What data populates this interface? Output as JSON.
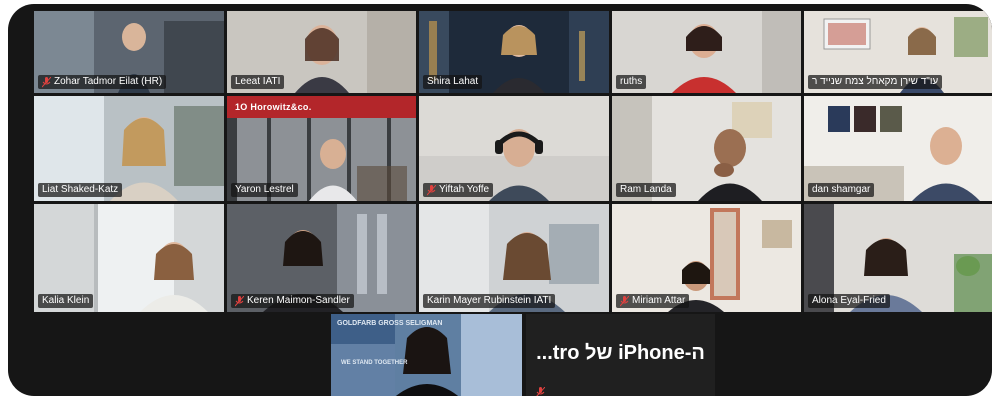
{
  "participants": [
    {
      "name": "Zohar Tadmor Eilat (HR)",
      "muted": true
    },
    {
      "name": "Leeat IATI",
      "muted": false
    },
    {
      "name": "Shira Lahat",
      "muted": false
    },
    {
      "name": "ruths",
      "muted": false
    },
    {
      "name": "עו\"ד שירן מקאחל צמח שנייד ר",
      "muted": false
    },
    {
      "name": "Liat Shaked-Katz",
      "muted": false
    },
    {
      "name": "Yaron Lestrel",
      "muted": false
    },
    {
      "name": "Yiftah Yoffe",
      "muted": true
    },
    {
      "name": "Ram Landa",
      "muted": false
    },
    {
      "name": "dan shamgar",
      "muted": false
    },
    {
      "name": "Kalia Klein",
      "muted": false
    },
    {
      "name": "Keren Maimon-Sandler",
      "muted": true
    },
    {
      "name": "Karin Mayer Rubinstein IATI",
      "muted": false
    },
    {
      "name": "Miriam Attar",
      "muted": true
    },
    {
      "name": "Alona Eyal-Fried",
      "muted": false
    }
  ],
  "background_texts": {
    "horowitz_logo": "1O Horowitz&co.",
    "corp_logo": "GOLDFARB GROSS SELIGMAN",
    "we_stand": "WE STAND TOGETHER"
  },
  "bottom_tile": {
    "display_name": "...tro של iPhone-ה"
  },
  "colors": {
    "window_bg": "#161616",
    "active_speaker_border": "#3bd36b",
    "muted_icon": "#e0413f"
  }
}
